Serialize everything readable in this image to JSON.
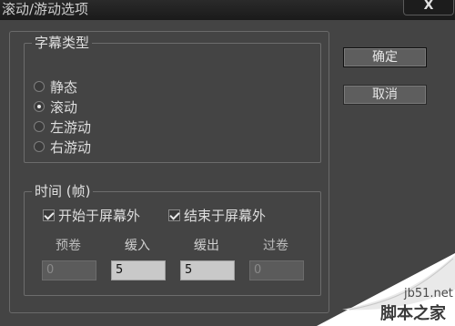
{
  "window": {
    "title": "滚动/游动选项",
    "close_label": "X"
  },
  "subtitle_type": {
    "legend": "字幕类型",
    "options": [
      {
        "label": "静态",
        "selected": false
      },
      {
        "label": "滚动",
        "selected": true
      },
      {
        "label": "左游动",
        "selected": false
      },
      {
        "label": "右游动",
        "selected": false
      }
    ]
  },
  "timing": {
    "legend": "时间 (帧)",
    "start_offscreen": {
      "label": "开始于屏幕外",
      "checked": true
    },
    "end_offscreen": {
      "label": "结束于屏幕外",
      "checked": true
    },
    "fields": [
      {
        "label": "预卷",
        "value": "0",
        "enabled": false
      },
      {
        "label": "缓入",
        "value": "5",
        "enabled": true
      },
      {
        "label": "缓出",
        "value": "5",
        "enabled": true
      },
      {
        "label": "过卷",
        "value": "0",
        "enabled": false
      }
    ]
  },
  "buttons": {
    "ok": "确定",
    "cancel": "取消"
  },
  "watermark": {
    "site": "jb51.net",
    "name": "脚本之家"
  }
}
